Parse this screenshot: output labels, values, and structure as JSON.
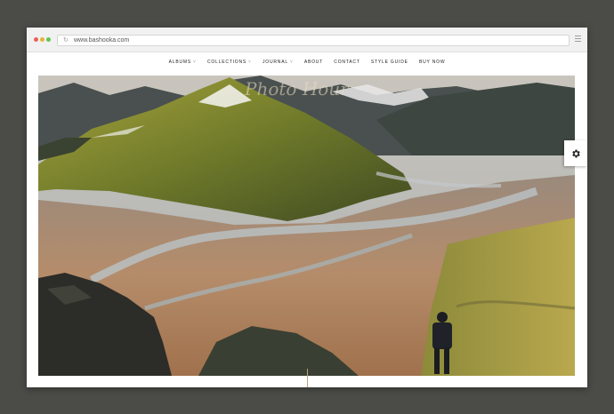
{
  "browser": {
    "url": "www.bashooka.com"
  },
  "nav": {
    "items": [
      {
        "label": "ALBUMS",
        "has_dropdown": true
      },
      {
        "label": "COLLECTIONS",
        "has_dropdown": true
      },
      {
        "label": "JOURNAL",
        "has_dropdown": true
      },
      {
        "label": "ABOUT",
        "has_dropdown": false
      },
      {
        "label": "CONTACT",
        "has_dropdown": false
      },
      {
        "label": "STYLE GUIDE",
        "has_dropdown": false
      },
      {
        "label": "BUY NOW",
        "has_dropdown": false
      }
    ],
    "caret": "˅"
  },
  "hero": {
    "logo_text": "Photo Hour"
  },
  "icons": {
    "settings": "gear-icon",
    "reload": "reload-icon",
    "menu": "hamburger-icon"
  },
  "colors": {
    "page_background": "#4b4c47",
    "accent_line": "#b8a477"
  }
}
